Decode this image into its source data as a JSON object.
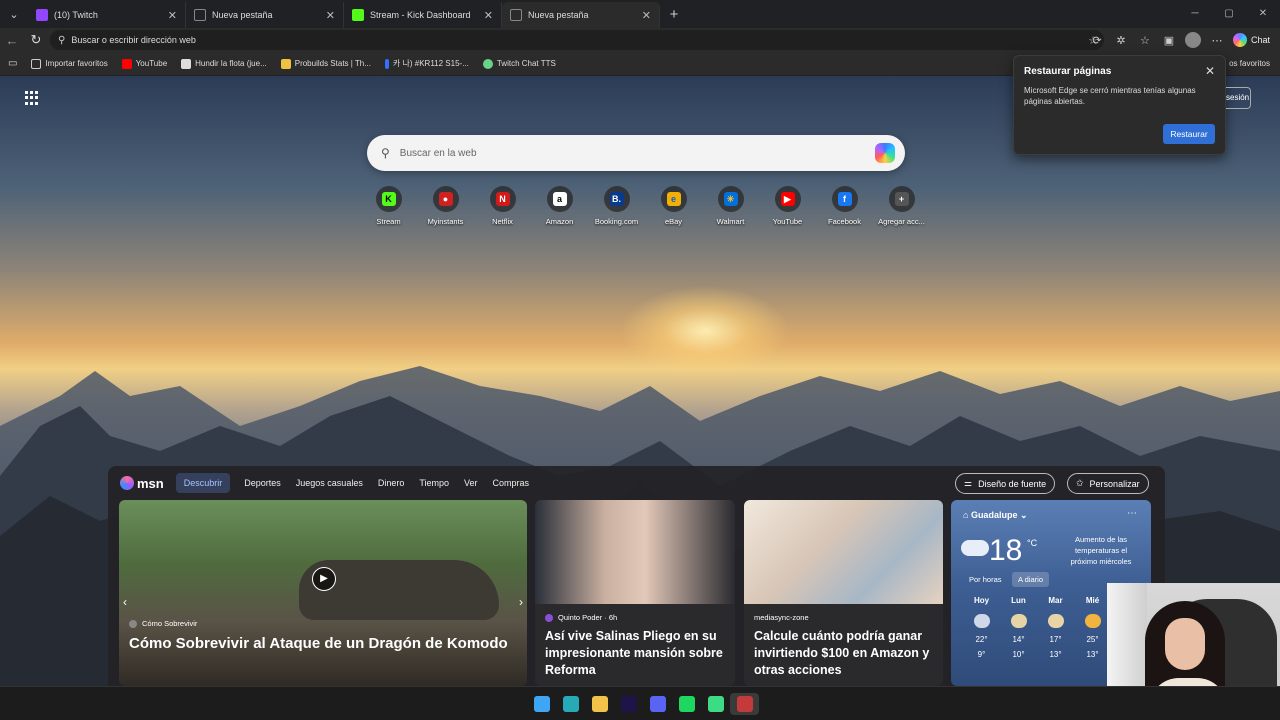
{
  "browser": {
    "tabs": [
      {
        "title": "(10) Twitch",
        "color": "#9146ff"
      },
      {
        "title": "Nueva pestaña",
        "color": "#777777"
      },
      {
        "title": "Stream - Kick Dashboard",
        "color": "#53fc18"
      },
      {
        "title": "Nueva pestaña",
        "color": "#777777"
      }
    ],
    "address_placeholder": "Buscar o escribir dirección web",
    "chat_label": "Chat"
  },
  "bookmarks": {
    "items": [
      {
        "label": "Importar favoritos",
        "color": "#cccccc"
      },
      {
        "label": "YouTube",
        "color": "#ff0000"
      },
      {
        "label": "Hundir la flota (jue...",
        "color": "#dddddd"
      },
      {
        "label": "Probuilds Stats | Th...",
        "color": "#f0c040"
      },
      {
        "label": "카 나) #KR112 S15-...",
        "color": "#3070ff"
      },
      {
        "label": "Twitch Chat TTS",
        "color": "#6ad38a"
      }
    ],
    "other": "os favoritos"
  },
  "newtab": {
    "search_placeholder": "Buscar en la web",
    "signin_partial": "sesión",
    "shortcuts": [
      {
        "label": "Stream",
        "glyph": "K",
        "color": "#53fc18",
        "text": "#000000"
      },
      {
        "label": "Myinstants",
        "glyph": "●",
        "color": "#d02020",
        "text": "#ffffff"
      },
      {
        "label": "Netflix",
        "glyph": "N",
        "color": "#d11a1a",
        "text": "#ffffff"
      },
      {
        "label": "Amazon",
        "glyph": "a",
        "color": "#ffffff",
        "text": "#000000"
      },
      {
        "label": "Booking.com",
        "glyph": "B.",
        "color": "#0a3a8c",
        "text": "#ffffff"
      },
      {
        "label": "eBay",
        "glyph": "e",
        "color": "#f5af02",
        "text": "#0064d2"
      },
      {
        "label": "Walmart",
        "glyph": "✳",
        "color": "#0071dc",
        "text": "#ffc220"
      },
      {
        "label": "YouTube",
        "glyph": "▶",
        "color": "#ff0000",
        "text": "#ffffff"
      },
      {
        "label": "Facebook",
        "glyph": "f",
        "color": "#1877f2",
        "text": "#ffffff"
      },
      {
        "label": "Agregar acc...",
        "glyph": "+",
        "color": "#555555",
        "text": "#ffffff"
      }
    ]
  },
  "restore_popup": {
    "title": "Restaurar páginas",
    "message": "Microsoft Edge se cerró mientras tenías algunas páginas abiertas.",
    "button": "Restaurar"
  },
  "msn": {
    "logo": "msn",
    "tabs": [
      "Descubrir",
      "Deportes",
      "Juegos casuales",
      "Dinero",
      "Tiempo",
      "Ver",
      "Compras"
    ],
    "font_button": "Diseño de fuente",
    "personalize_button": "Personalizar",
    "cards": [
      {
        "source": "Cómo Sobrevivir",
        "headline": "Cómo Sobrevivir al Ataque de un Dragón de Komodo",
        "dot": "#888888"
      },
      {
        "source": "Quinto Poder · 6h",
        "headline": "Así vive Salinas Pliego en su impresionante mansión sobre Reforma",
        "dot": "#8a4fd6"
      },
      {
        "source": "mediasync-zone",
        "headline": "Calcule cuánto podría ganar invirtiendo $100 en Amazon y otras acciones",
        "dot": ""
      }
    ],
    "weather": {
      "location": "Guadalupe",
      "temp": "18",
      "unit": "°C",
      "note": "Aumento de las temperaturas el próximo miércoles",
      "tab_hourly": "Por horas",
      "tab_daily": "A diario",
      "days": [
        {
          "name": "Hoy",
          "hi": "22°",
          "lo": "9°",
          "icon": "#cfd8e8"
        },
        {
          "name": "Lun",
          "hi": "14°",
          "lo": "10°",
          "icon": "#e7d3a5"
        },
        {
          "name": "Mar",
          "hi": "17°",
          "lo": "13°",
          "icon": "#e7d3a5"
        },
        {
          "name": "Mié",
          "hi": "25°",
          "lo": "13°",
          "icon": "#f2b441"
        }
      ]
    }
  },
  "taskbar": {
    "apps": [
      {
        "name": "windows-start-icon",
        "color": "#3ea6f5"
      },
      {
        "name": "edge-icon",
        "color": "#27a9b6"
      },
      {
        "name": "file-explorer-icon",
        "color": "#f2c14a"
      },
      {
        "name": "premiere-icon",
        "color": "#1f1448"
      },
      {
        "name": "discord-icon",
        "color": "#5865f2"
      },
      {
        "name": "spotify-icon",
        "color": "#1ed760"
      },
      {
        "name": "android-app-icon",
        "color": "#3ddc84"
      },
      {
        "name": "app-icon",
        "color": "#c23a3a"
      }
    ]
  }
}
